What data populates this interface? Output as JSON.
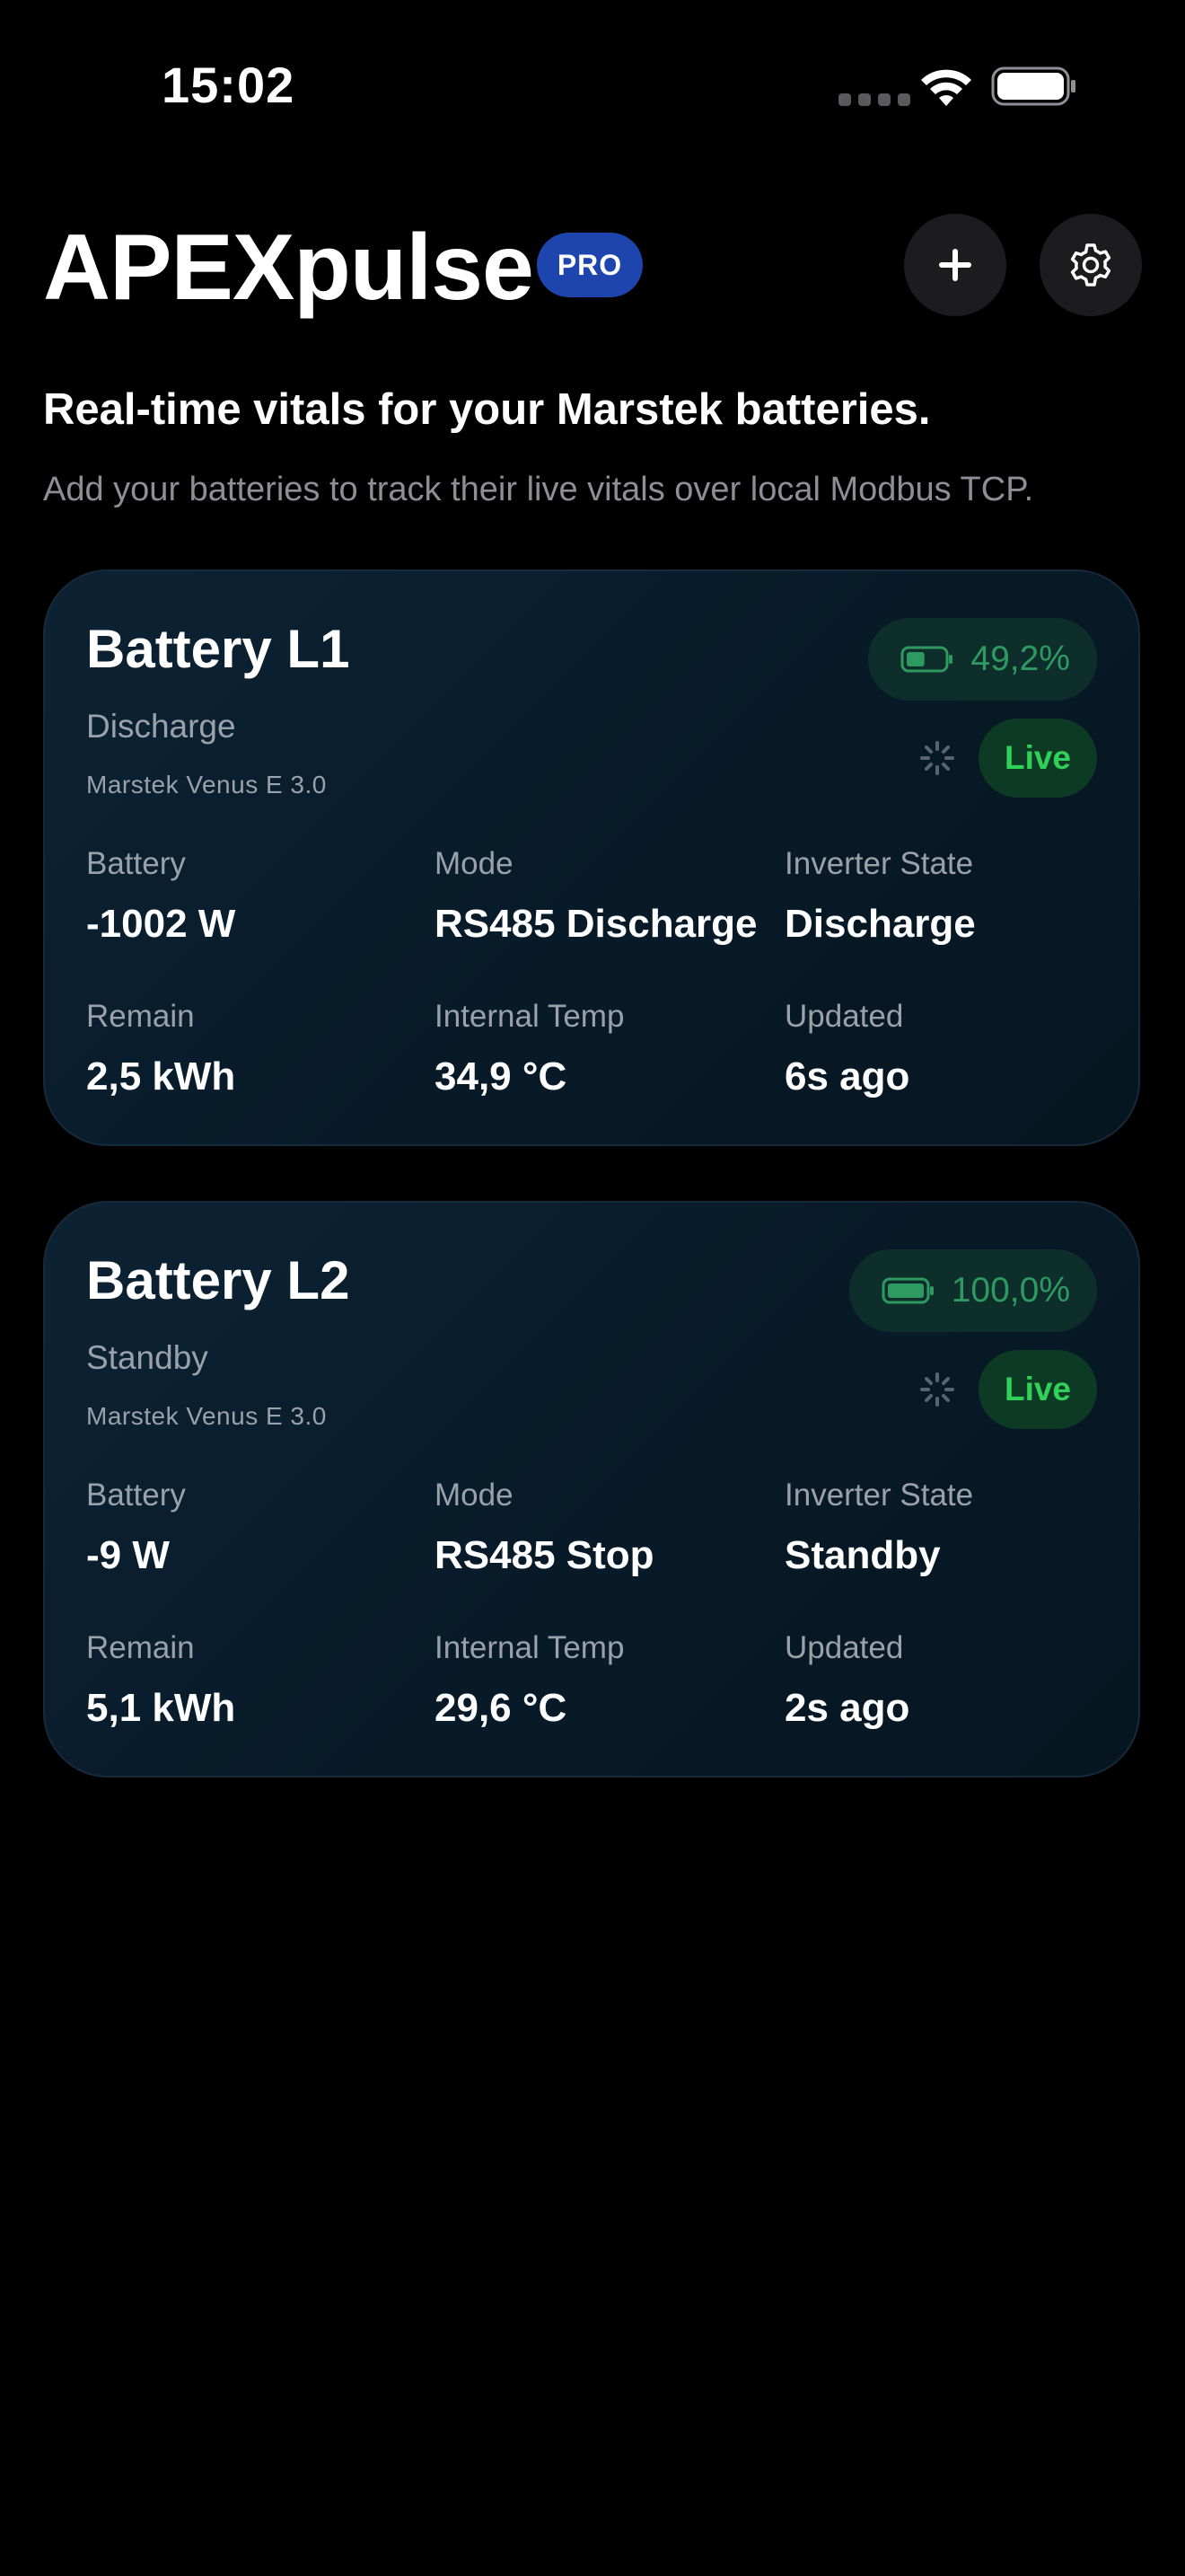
{
  "status_bar": {
    "time": "15:02"
  },
  "header": {
    "app_title": "APEXpulse",
    "badge": "PRO",
    "add_icon": "plus-icon",
    "settings_icon": "gear-icon"
  },
  "intro": {
    "headline": "Real-time vitals for your Marstek batteries.",
    "subline": "Add your batteries to track their live vitals over local Modbus TCP."
  },
  "colors": {
    "background": "#000000",
    "card": "#0a1e2d",
    "pro_badge": "#1d45ad",
    "live_green": "#30d158",
    "soc_green": "#2f9a60",
    "muted_text": "#9aa1ab"
  },
  "batteries": [
    {
      "name": "Battery L1",
      "state": "Discharge",
      "model": "Marstek Venus E 3.0",
      "soc": "49,2%",
      "soc_fraction": 0.492,
      "live": "Live",
      "metrics": {
        "battery_label": "Battery",
        "battery_value": "-1002 W",
        "mode_label": "Mode",
        "mode_value": "RS485 Discharge",
        "inverter_label": "Inverter State",
        "inverter_value": "Discharge",
        "remain_label": "Remain",
        "remain_value": "2,5 kWh",
        "temp_label": "Internal Temp",
        "temp_value": "34,9 °C",
        "updated_label": "Updated",
        "updated_value": "6s ago"
      }
    },
    {
      "name": "Battery L2",
      "state": "Standby",
      "model": "Marstek Venus E 3.0",
      "soc": "100,0%",
      "soc_fraction": 1.0,
      "live": "Live",
      "metrics": {
        "battery_label": "Battery",
        "battery_value": "-9 W",
        "mode_label": "Mode",
        "mode_value": "RS485 Stop",
        "inverter_label": "Inverter State",
        "inverter_value": "Standby",
        "remain_label": "Remain",
        "remain_value": "5,1 kWh",
        "temp_label": "Internal Temp",
        "temp_value": "29,6 °C",
        "updated_label": "Updated",
        "updated_value": "2s ago"
      }
    }
  ]
}
